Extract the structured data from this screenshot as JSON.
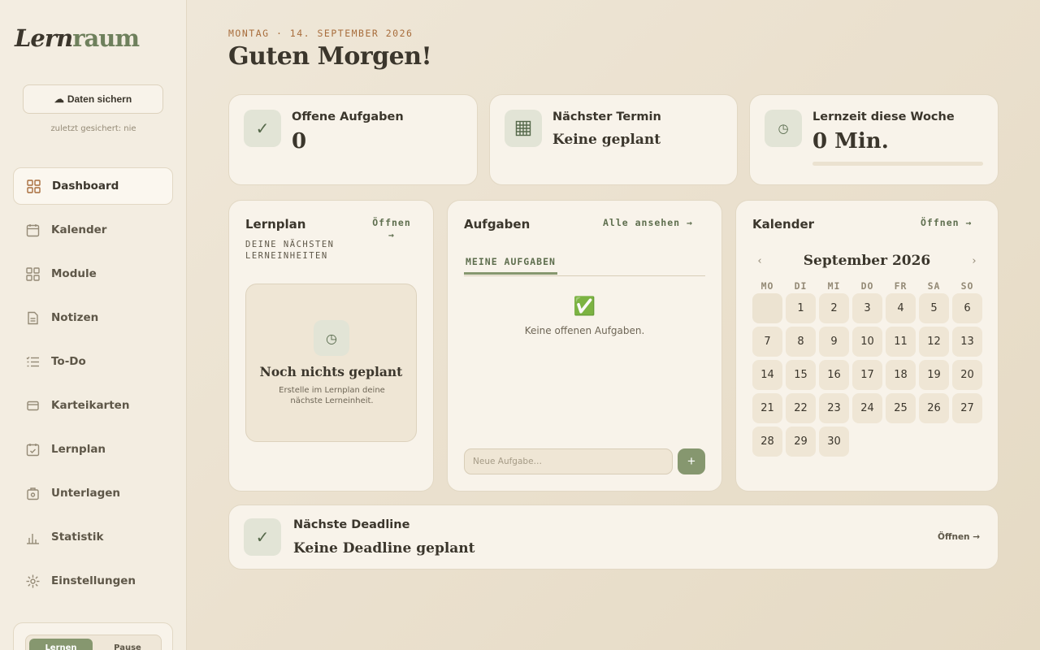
{
  "sidebar": {
    "logo_part1": "Lern",
    "logo_part2": "raum",
    "backup_label": "Daten sichern",
    "backup_status": "zuletzt gesichert: nie",
    "items": [
      {
        "label": "Dashboard",
        "icon": "dashboard-icon"
      },
      {
        "label": "Kalender",
        "icon": "calendar-icon"
      },
      {
        "label": "Module",
        "icon": "module-icon"
      },
      {
        "label": "Notizen",
        "icon": "notes-icon"
      },
      {
        "label": "To-Do",
        "icon": "todo-icon"
      },
      {
        "label": "Karteikarten",
        "icon": "flashcards-icon"
      },
      {
        "label": "Lernplan",
        "icon": "studyplan-icon"
      },
      {
        "label": "Unterlagen",
        "icon": "documents-icon"
      },
      {
        "label": "Statistik",
        "icon": "statistics-icon"
      },
      {
        "label": "Einstellungen",
        "icon": "settings-icon"
      }
    ],
    "timer": {
      "learn": "Lernen",
      "pause": "Pause"
    }
  },
  "header": {
    "date": "MONTAG · 14. SEPTEMBER 2026",
    "greeting": "Guten Morgen!"
  },
  "stats": {
    "open_tasks": {
      "label": "Offene Aufgaben",
      "value": "0"
    },
    "next_event": {
      "label": "Nächster Termin",
      "value": "Keine geplant"
    },
    "study_time": {
      "label": "Lernzeit diese Woche",
      "value": "0 Min.",
      "progress": 0
    }
  },
  "studyplan": {
    "title": "Lernplan",
    "link": "Öffnen →",
    "subtitle": "DEINE NÄCHSTEN LERNEINHEITEN",
    "empty_title": "Noch nichts geplant",
    "empty_text": "Erstelle im Lernplan deine nächste Lerneinheit."
  },
  "tasks": {
    "title": "Aufgaben",
    "link": "Alle ansehen →",
    "tab": "MEINE AUFGABEN",
    "empty_text": "Keine offenen Aufgaben.",
    "input_placeholder": "Neue Aufgabe…",
    "add_label": "+"
  },
  "calendar": {
    "title": "Kalender",
    "link": "Öffnen →",
    "month": "September 2026",
    "prev": "‹",
    "next": "›",
    "weekdays": [
      "MO",
      "DI",
      "MI",
      "DO",
      "FR",
      "SA",
      "SO"
    ],
    "leading_blanks": 1,
    "days": 30
  },
  "deadline": {
    "label": "Nächste Deadline",
    "value": "Keine Deadline geplant",
    "link": "Öffnen →"
  },
  "colors": {
    "accent": "#86976f",
    "date_accent": "#a86d3c",
    "background": "#ece3d1"
  }
}
